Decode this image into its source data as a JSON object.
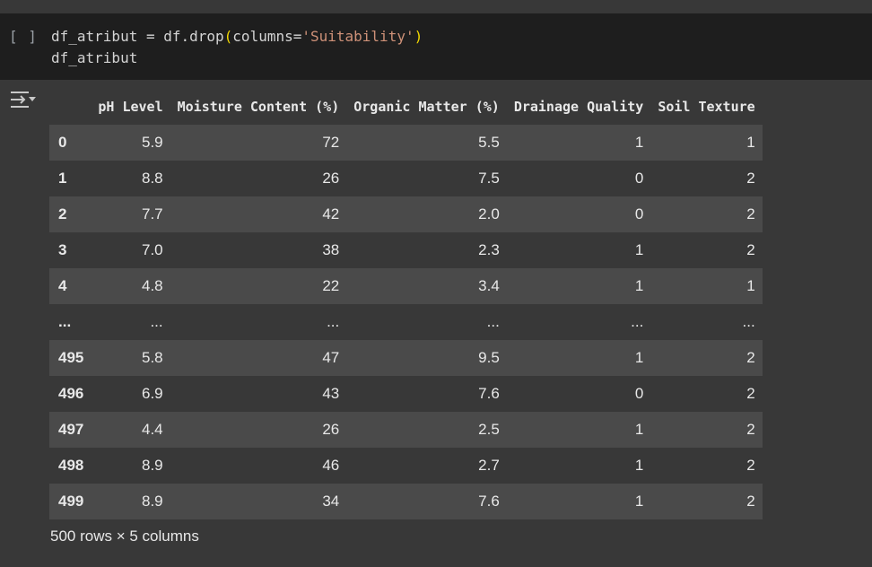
{
  "cell": {
    "run_indicator": "[ ]",
    "code_line1_a": "df_atribut = df.drop",
    "code_line1_paren_open": "(",
    "code_line1_b": "columns=",
    "code_line1_str": "'Suitability'",
    "code_line1_paren_close": ")",
    "code_line2": "df_atribut"
  },
  "output": {
    "icon": "output-toggle-icon",
    "columns": [
      "",
      "pH Level",
      "Moisture Content (%)",
      "Organic Matter (%)",
      "Drainage Quality",
      "Soil Texture"
    ],
    "rows": [
      [
        "0",
        "5.9",
        "72",
        "5.5",
        "1",
        "1"
      ],
      [
        "1",
        "8.8",
        "26",
        "7.5",
        "0",
        "2"
      ],
      [
        "2",
        "7.7",
        "42",
        "2.0",
        "0",
        "2"
      ],
      [
        "3",
        "7.0",
        "38",
        "2.3",
        "1",
        "2"
      ],
      [
        "4",
        "4.8",
        "22",
        "3.4",
        "1",
        "1"
      ],
      [
        "...",
        "...",
        "...",
        "...",
        "...",
        "..."
      ],
      [
        "495",
        "5.8",
        "47",
        "9.5",
        "1",
        "2"
      ],
      [
        "496",
        "6.9",
        "43",
        "7.6",
        "0",
        "2"
      ],
      [
        "497",
        "4.4",
        "26",
        "2.5",
        "1",
        "2"
      ],
      [
        "498",
        "8.9",
        "46",
        "2.7",
        "1",
        "2"
      ],
      [
        "499",
        "8.9",
        "34",
        "7.6",
        "1",
        "2"
      ]
    ],
    "footer": "500 rows × 5 columns"
  }
}
